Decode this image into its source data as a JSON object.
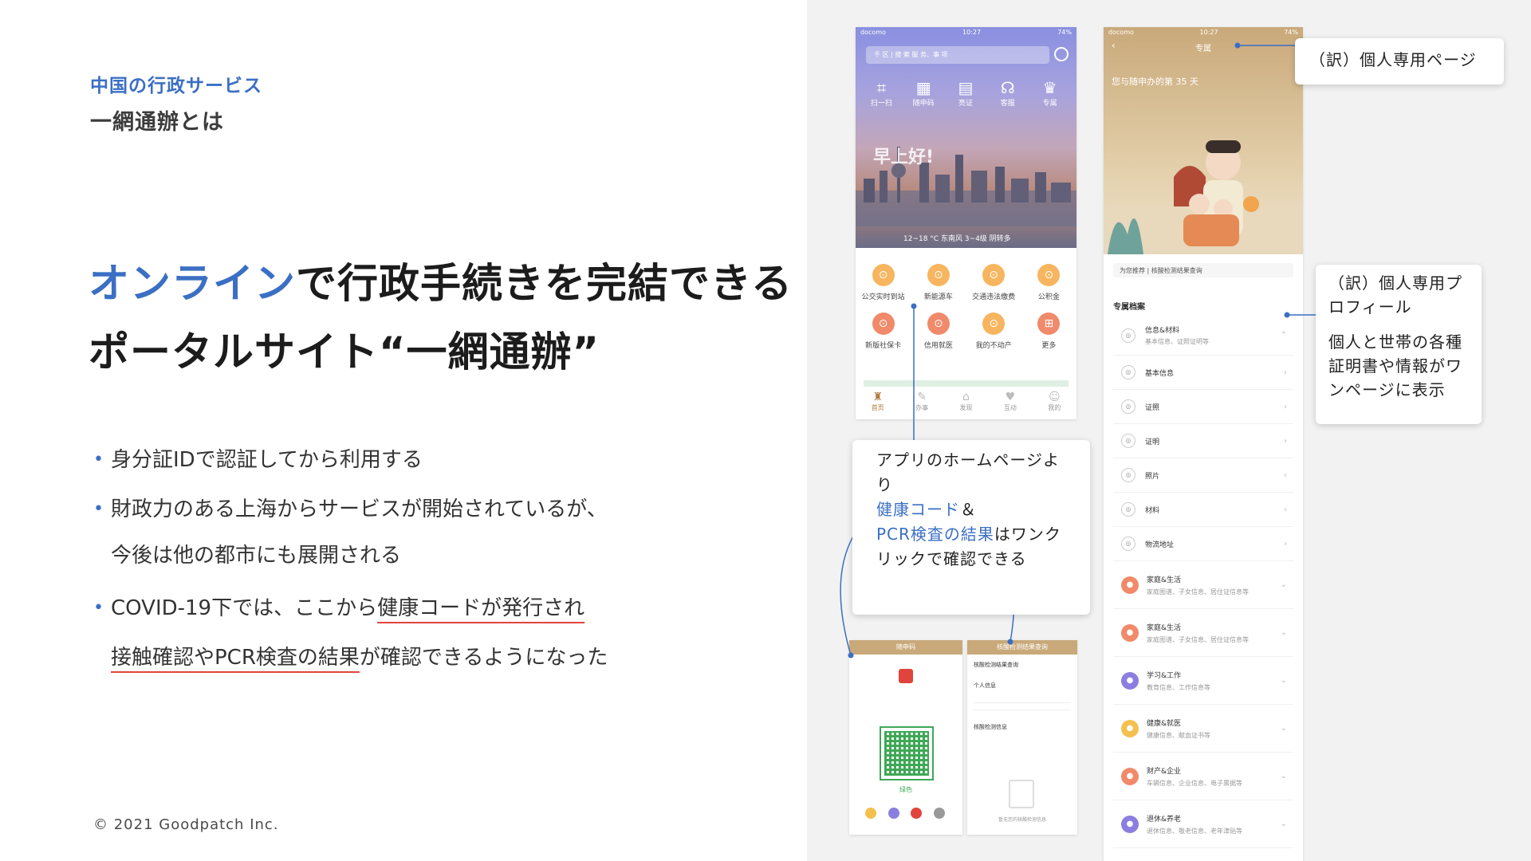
{
  "slide": {
    "kicker": "中国の行政サービス",
    "subtitle": "一網通辦とは",
    "headline": {
      "line1_accent": "オンライン",
      "line1_rest": "で行政手続きを完結できる",
      "line2": "ポータルサイト“一網通辦”"
    },
    "bullets": [
      {
        "text": "身分証IDで認証してから利用する"
      },
      {
        "text": "財政力のある上海からサービスが開始されているが、",
        "cont": "今後は他の都市にも展開される"
      },
      {
        "text_pre": "COVID-19下では、ここから",
        "text_u": "健康コードが発行され",
        "cont_u": "接触確認やPCR検査の結果",
        "cont_rest": "が確認できるようになった"
      }
    ],
    "copyright": "© 2021 Goodpatch Inc."
  },
  "phone_home": {
    "status": {
      "carrier": "docomo",
      "time": "10:27",
      "battery": "74%"
    },
    "search_placeholder": "千 区 | 搜 索 服 务、事 项",
    "top_icons": [
      {
        "label": "扫一扫",
        "icon": "scan-icon",
        "glyph": "⌗"
      },
      {
        "label": "随申码",
        "icon": "qr-icon",
        "glyph": "▦"
      },
      {
        "label": "亮证",
        "icon": "card-icon",
        "glyph": "▤"
      },
      {
        "label": "客服",
        "icon": "headset-icon",
        "glyph": "☊"
      },
      {
        "label": "专属",
        "icon": "crown-icon",
        "glyph": "♛"
      }
    ],
    "greeting": "早上好!",
    "weather": "12~18 °C 东南风 3~4级    阴转多",
    "services": [
      {
        "label": "公交实时到站",
        "glyph": "⊙",
        "tone": "orange"
      },
      {
        "label": "新能源车",
        "glyph": "⊙",
        "tone": "orange"
      },
      {
        "label": "交通违法缴费",
        "glyph": "⊙",
        "tone": "orange"
      },
      {
        "label": "公积金",
        "glyph": "⊙",
        "tone": "orange"
      },
      {
        "label": "新版社保卡",
        "glyph": "⊙",
        "tone": "red"
      },
      {
        "label": "信用就医",
        "glyph": "⊙",
        "tone": "red"
      },
      {
        "label": "我的不动产",
        "glyph": "⊙",
        "tone": "orange"
      },
      {
        "label": "更多",
        "glyph": "⊞",
        "tone": "red"
      }
    ],
    "tabs": [
      {
        "label": "首页",
        "glyph": "♜",
        "active": true
      },
      {
        "label": "办事",
        "glyph": "✎",
        "active": false
      },
      {
        "label": "发现",
        "glyph": "⌂",
        "active": false
      },
      {
        "label": "互动",
        "glyph": "♥",
        "active": false
      },
      {
        "label": "我的",
        "glyph": "☺",
        "active": false
      }
    ]
  },
  "phone_profile": {
    "status": {
      "carrier": "docomo",
      "time": "10:27",
      "battery": "74%"
    },
    "title": "专属",
    "days_text": "您与随申办的第 35 天",
    "recommend": "为您推荐 | 核酸检测结果查询",
    "section": "专属档案",
    "items": [
      {
        "label": "信息&材料",
        "sub": "基本信息、证照证明等"
      },
      {
        "label": "基本信息"
      },
      {
        "label": "证照"
      },
      {
        "label": "证明"
      },
      {
        "label": "照片"
      },
      {
        "label": "材料"
      },
      {
        "label": "物流地址"
      }
    ],
    "categories": [
      {
        "label": "家庭&生活",
        "sub": "家庭图谱、子女信息、居住证信息等",
        "tone": "red"
      },
      {
        "label": "家庭&生活",
        "sub": "家庭图谱、子女信息、居住证信息等",
        "tone": "red"
      },
      {
        "label": "学习&工作",
        "sub": "教育信息、工作信息等",
        "tone": "purple"
      },
      {
        "label": "健康&就医",
        "sub": "健康信息、献血证书等",
        "tone": "yellow"
      },
      {
        "label": "财产&企业",
        "sub": "车辆信息、企业信息、电子票据等",
        "tone": "red"
      },
      {
        "label": "退休&养老",
        "sub": "退休信息、敬老信息、老年津贴等",
        "tone": "purple"
      }
    ]
  },
  "phone_code": {
    "title": "随申码",
    "status_label": "绿色"
  },
  "phone_pcr": {
    "title": "核酸检测结果查询",
    "row1": "个人信息",
    "row2": "核酸检测信息",
    "empty": "暂无您的核酸检测信息"
  },
  "callouts": {
    "personal_page": "（訳）個人専用ページ",
    "profile": {
      "line1": "（訳）個人専用プロフィール",
      "line2": "個人と世帯の各種証明書や情報がワンページに表示"
    },
    "home": {
      "pre": "アプリのホームページより",
      "accent1": "健康コード",
      "mid": "＆",
      "accent2": "PCR検査の結果",
      "post": "はワンクリックで確認できる"
    }
  },
  "colors": {
    "accent": "#3b6fc4",
    "underline": "#e0443c",
    "panel_bg": "#f2f2f2"
  }
}
